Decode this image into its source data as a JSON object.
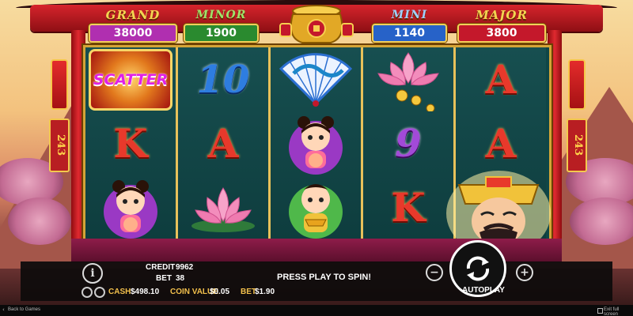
{
  "jackpots": {
    "grand": {
      "name": "GRAND",
      "value": "38000",
      "color": "#b02fb0"
    },
    "minor": {
      "name": "MINOR",
      "value": "1900",
      "color": "#2a8a2f"
    },
    "mini": {
      "name": "MINI",
      "value": "1140",
      "color": "#2762c8"
    },
    "major": {
      "name": "MAJOR",
      "value": "3800",
      "color": "#c4182b"
    }
  },
  "side_plaque": "243",
  "reels": [
    [
      "SCATTER",
      "K",
      "girl"
    ],
    [
      "10",
      "A",
      "lotus"
    ],
    [
      "fan",
      "girl",
      "boy"
    ],
    [
      "lotus",
      "9",
      "K"
    ],
    [
      "A",
      "A",
      "fortune-god"
    ]
  ],
  "symbols": {
    "scatter_label": "SCATTER",
    "ten": "10",
    "nine": "9",
    "king": "K",
    "ace": "A"
  },
  "status": {
    "credit_label": "CREDIT",
    "credit_value": "9962",
    "bet_label": "BET",
    "bet_value": "38",
    "message": "PRESS PLAY TO SPIN!"
  },
  "footer_stats": {
    "cash_label": "CASH",
    "cash_value": "$498.10",
    "coin_label": "COIN VALUE",
    "coin_value": "$0.05",
    "bet_label": "BET",
    "bet_value": "$1.90"
  },
  "controls": {
    "info": "i",
    "minus": "−",
    "plus": "+",
    "autoplay": "AUTOPLAY"
  },
  "footer": {
    "back": "Back to Games",
    "exit": "Exit full screen"
  },
  "icons": [
    "info-icon",
    "settings-icon",
    "sound-icon",
    "spin-arrows-icon",
    "back-arrow-icon",
    "fullscreen-icon"
  ]
}
